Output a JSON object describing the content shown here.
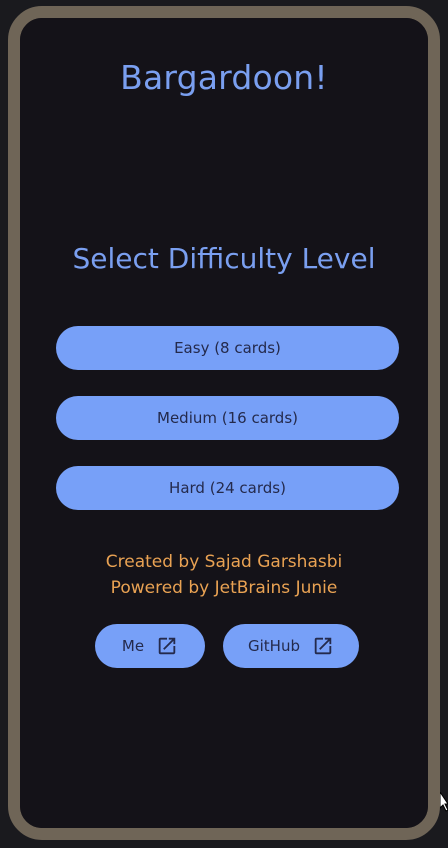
{
  "app": {
    "title": "Bargardoon!"
  },
  "difficulty": {
    "heading": "Select Difficulty Level",
    "options": [
      {
        "label": "Easy (8 cards)"
      },
      {
        "label": "Medium (16 cards)"
      },
      {
        "label": "Hard (24 cards)"
      }
    ]
  },
  "credits": {
    "created_by": "Created by Sajad Garshasbi",
    "powered_by": "Powered by JetBrains Junie"
  },
  "links": [
    {
      "label": "Me",
      "icon": "open-in-new-icon"
    },
    {
      "label": "GitHub",
      "icon": "open-in-new-icon"
    }
  ],
  "colors": {
    "background": "#141218",
    "bezel": "#6f6557",
    "accent": "#77a0f8",
    "title": "#7a9ff0",
    "credit_text": "#e9a253",
    "button_text": "#242a4c"
  }
}
